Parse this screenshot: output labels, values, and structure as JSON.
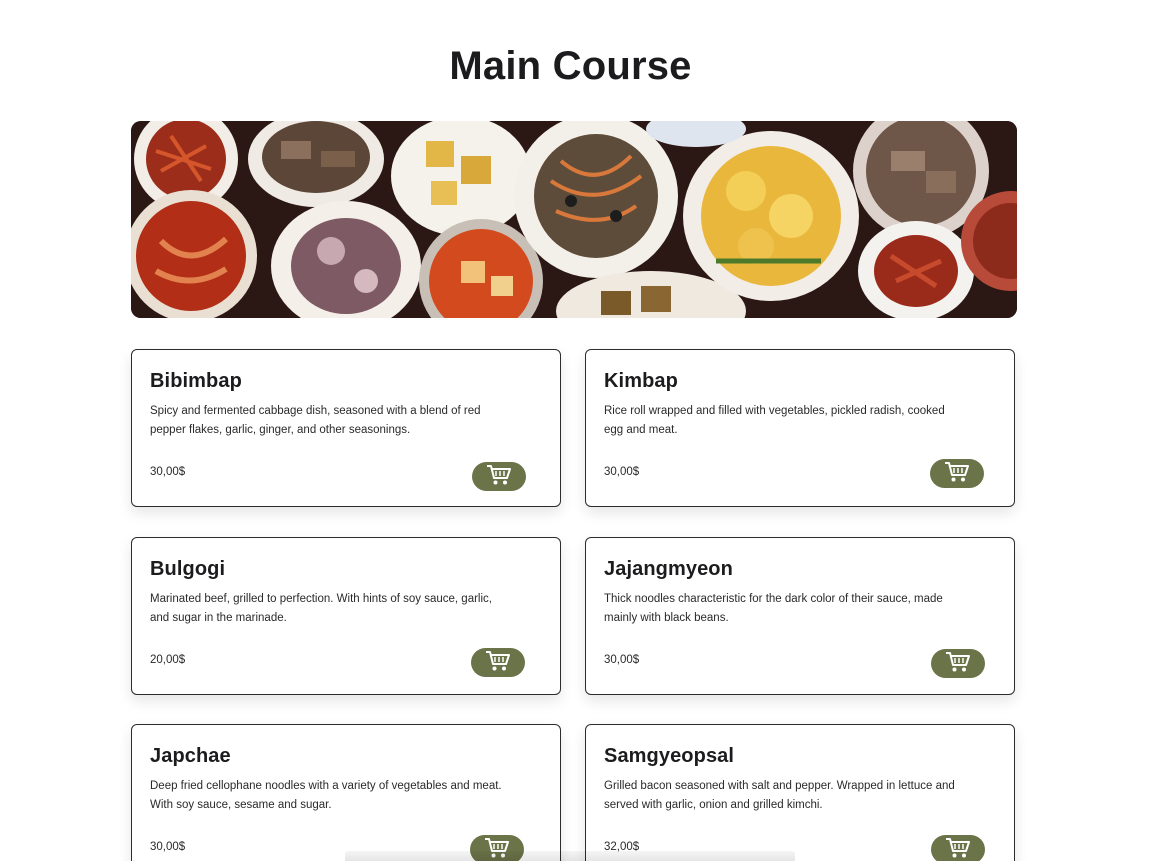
{
  "page": {
    "title": "Main Course"
  },
  "colors": {
    "accent": "#6b7348",
    "text": "#1c1c1e",
    "card_border": "#2c2c2e"
  },
  "hero": {
    "image_subject": "assorted Korean dishes on plates"
  },
  "menu": {
    "items": [
      {
        "name": "Bibimbap",
        "description": "Spicy and fermented cabbage dish, seasoned with a blend of red pepper flakes, garlic, ginger, and other seasonings.",
        "price": "30,00$",
        "icon": "shopping-cart-icon"
      },
      {
        "name": "Kimbap",
        "description": "Rice roll wrapped and filled with vegetables, pickled radish, cooked egg and meat.",
        "price": "30,00$",
        "icon": "shopping-cart-icon"
      },
      {
        "name": "Bulgogi",
        "description": "Marinated beef, grilled to perfection. With hints of soy sauce, garlic, and sugar in the marinade.",
        "price": "20,00$",
        "icon": "shopping-cart-icon"
      },
      {
        "name": "Jajangmyeon",
        "description": "Thick noodles characteristic for the dark color of their sauce, made mainly with black beans.",
        "price": "30,00$",
        "icon": "shopping-cart-icon"
      },
      {
        "name": "Japchae",
        "description": "Deep fried cellophane noodles with a variety of vegetables and meat. With soy sauce, sesame and sugar.",
        "price": "30,00$",
        "icon": "shopping-cart-icon"
      },
      {
        "name": "Samgyeopsal",
        "description": "Grilled bacon seasoned with salt and pepper. Wrapped in lettuce and served with garlic, onion and grilled kimchi.",
        "price": "32,00$",
        "icon": "shopping-cart-icon"
      }
    ]
  }
}
